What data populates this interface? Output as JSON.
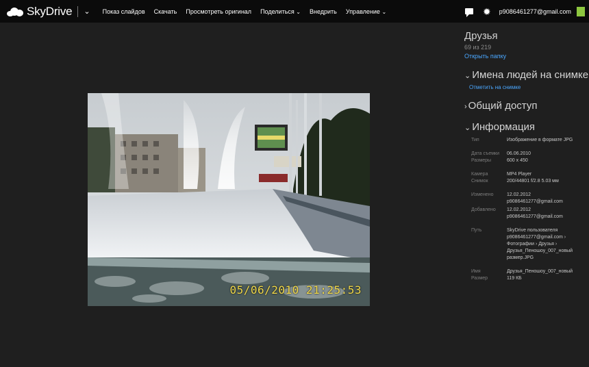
{
  "app": {
    "brand": "SkyDrive",
    "menu_chevron": "⌄",
    "commands": [
      {
        "label": "Показ слайдов",
        "dropdown": false
      },
      {
        "label": "Скачать",
        "dropdown": false
      },
      {
        "label": "Просмотреть оригинал",
        "dropdown": false
      },
      {
        "label": "Поделиться",
        "dropdown": true
      },
      {
        "label": "Внедрить",
        "dropdown": false
      },
      {
        "label": "Управление",
        "dropdown": true
      }
    ],
    "user_email": "p9086461277@gmail.com",
    "avatar_color": "#8dc63f"
  },
  "photo": {
    "timestamp": "05/06/2010 21:25:53",
    "timestamp_color": "#f0d84a"
  },
  "panel": {
    "album_title": "Друзья",
    "count": "69 из 219",
    "open_folder": "Открыть папку",
    "people": {
      "title": "Имена людей на снимке",
      "tag_link": "Отметить на снимке"
    },
    "sharing": {
      "title": "Общий доступ"
    },
    "info": {
      "title": "Информация",
      "groups": [
        [
          {
            "k": "Тип",
            "v": "Изображение в формате JPG"
          }
        ],
        [
          {
            "k": "Дата съемки",
            "v": "06.06.2010"
          },
          {
            "k": "Размеры",
            "v": "600 x 450"
          }
        ],
        [
          {
            "k": "Камера",
            "v": "MP4 Player"
          },
          {
            "k": "Снимок",
            "v": "200/44801 f/2.8 5.03 мм"
          }
        ],
        [
          {
            "k": "Изменено",
            "v": "12.02.2012 p9086461277@gmail.com"
          }
        ],
        [
          {
            "k": "Добавлено",
            "v": "12.02.2012 p9086461277@gmail.com"
          }
        ],
        [
          {
            "k": "Путь",
            "v": "SkyDrive пользователя p9086461277@gmail.com › Фотографии › Друзья › Друзья_Пеношоу_007_новый размер.JPG"
          }
        ],
        [
          {
            "k": "Имя",
            "v": "Друзья_Пеношоу_007_новый"
          },
          {
            "k": "Размер",
            "v": "119 КБ"
          }
        ]
      ]
    }
  },
  "colors": {
    "background": "#1f1f1f",
    "topbar": "#0b0b0b",
    "link": "#4aa7ff"
  }
}
